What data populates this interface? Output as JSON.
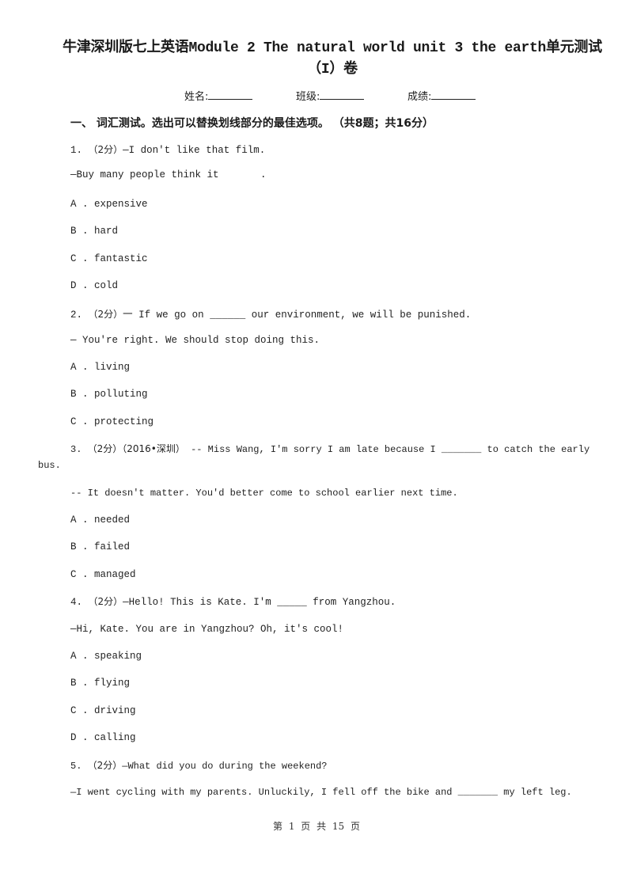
{
  "document": {
    "title_line1": "牛津深圳版七上英语Module 2 The natural world unit 3 the earth单元测试",
    "title_line2": "（I）卷",
    "meta": {
      "name_label": "姓名:",
      "class_label": "班级:",
      "score_label": "成绩:"
    },
    "section_heading": "一、  词汇测试。选出可以替换划线部分的最佳选项。 （共8题；共16分）",
    "questions": [
      {
        "number": "1.",
        "points": "（2分）",
        "stem": "—I don't like that film.",
        "reply": "—Buy many people think it       .",
        "options": [
          "A . expensive",
          "B . hard",
          "C . fantastic",
          "D . cold"
        ]
      },
      {
        "number": "2.",
        "points": "（2分）",
        "stem": "一 If we go on ______ our environment, we will be punished.",
        "reply": "— You're right. We should stop doing this.",
        "options": [
          "A . living",
          "B . polluting",
          "C . protecting"
        ]
      },
      {
        "number": "3.",
        "points": "（2分）",
        "source": "（2016•深圳）",
        "stem": "-- Miss Wang, I'm sorry I am late because I _______ to catch the early",
        "stem_cont": "bus.",
        "reply": "-- It doesn't matter. You'd better come to school earlier next time.",
        "options": [
          "A . needed",
          "B . failed",
          "C . managed"
        ]
      },
      {
        "number": "4.",
        "points": "（2分）",
        "stem": "—Hello! This is Kate. I'm _____ from Yangzhou.",
        "reply": "—Hi, Kate. You are in Yangzhou? Oh, it's cool!",
        "options": [
          "A . speaking",
          "B . flying",
          "C . driving",
          "D . calling"
        ]
      },
      {
        "number": "5.",
        "points": "（2分）",
        "stem": "—What did you do during the weekend?",
        "reply": "—I went cycling with my parents. Unluckily, I fell off the bike and _______ my left leg."
      }
    ],
    "footer": "第 1 页 共 15 页"
  }
}
